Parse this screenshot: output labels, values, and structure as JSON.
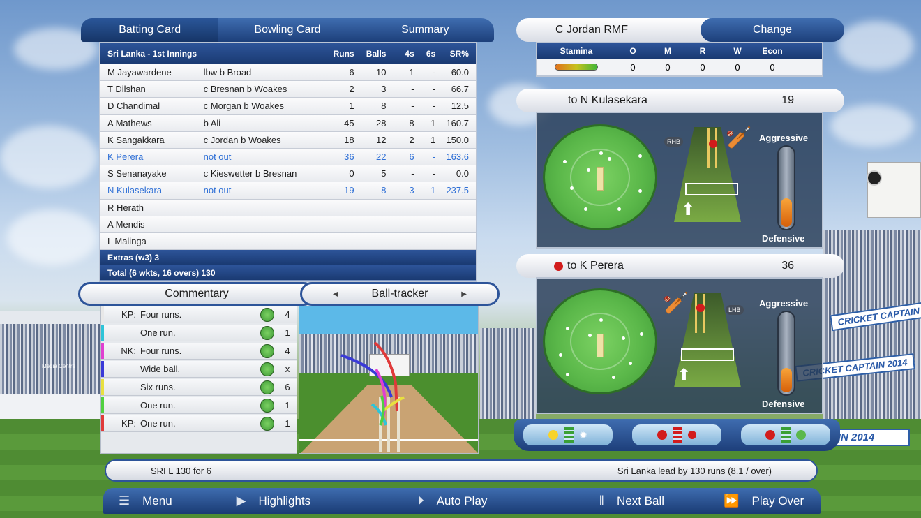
{
  "tabs": [
    "Batting Card",
    "Bowling Card",
    "Summary"
  ],
  "batting": {
    "innings_title": "Sri Lanka - 1st Innings",
    "headers": [
      "Runs",
      "Balls",
      "4s",
      "6s",
      "SR%"
    ],
    "rows": [
      {
        "name": "M Jayawardene",
        "how": "lbw b Broad",
        "runs": "6",
        "balls": "10",
        "fours": "1",
        "sixes": "-",
        "sr": "60.0"
      },
      {
        "name": "T Dilshan",
        "how": "c Bresnan b Woakes",
        "runs": "2",
        "balls": "3",
        "fours": "-",
        "sixes": "-",
        "sr": "66.7"
      },
      {
        "name": "D Chandimal",
        "how": "c Morgan b Woakes",
        "runs": "1",
        "balls": "8",
        "fours": "-",
        "sixes": "-",
        "sr": "12.5"
      },
      {
        "name": "A Mathews",
        "how": "b Ali",
        "runs": "45",
        "balls": "28",
        "fours": "8",
        "sixes": "1",
        "sr": "160.7"
      },
      {
        "name": "K Sangakkara",
        "how": "c Jordan b Woakes",
        "runs": "18",
        "balls": "12",
        "fours": "2",
        "sixes": "1",
        "sr": "150.0"
      },
      {
        "name": "K Perera",
        "how": "not out",
        "runs": "36",
        "balls": "22",
        "fours": "6",
        "sixes": "-",
        "sr": "163.6"
      },
      {
        "name": "S Senanayake",
        "how": "c Kieswetter b Bresnan",
        "runs": "0",
        "balls": "5",
        "fours": "-",
        "sixes": "-",
        "sr": "0.0"
      },
      {
        "name": "N Kulasekara",
        "how": "not out",
        "runs": "19",
        "balls": "8",
        "fours": "3",
        "sixes": "1",
        "sr": "237.5"
      },
      {
        "name": "R Herath",
        "how": "",
        "runs": "",
        "balls": "",
        "fours": "",
        "sixes": "",
        "sr": ""
      },
      {
        "name": "A Mendis",
        "how": "",
        "runs": "",
        "balls": "",
        "fours": "",
        "sixes": "",
        "sr": ""
      },
      {
        "name": "L Malinga",
        "how": "",
        "runs": "",
        "balls": "",
        "fours": "",
        "sixes": "",
        "sr": ""
      }
    ],
    "extras": "Extras (w3) 3",
    "total": "Total (6 wkts, 16 overs) 130"
  },
  "bowler": {
    "name": "C Jordan RMF",
    "change_label": "Change",
    "headers": [
      "Stamina",
      "O",
      "M",
      "R",
      "W",
      "Econ"
    ],
    "values": [
      "0",
      "0",
      "0",
      "0",
      "0"
    ],
    "stamina": 1.0
  },
  "field1": {
    "label": "to N Kulasekara",
    "score": "19",
    "hand": "RHB",
    "aggressive": "Aggressive",
    "defensive": "Defensive",
    "level": 0.35
  },
  "field2": {
    "label": "to K Perera",
    "score": "36",
    "hand": "LHB",
    "aggressive": "Aggressive",
    "defensive": "Defensive",
    "level": 0.3
  },
  "lower_tabs": {
    "commentary": "Commentary",
    "ball_tracker": "Ball-tracker"
  },
  "commentary": [
    {
      "who": "KP:",
      "text": "Four runs.",
      "val": "4",
      "color": "#e8e8e8"
    },
    {
      "who": "",
      "text": "One run.",
      "val": "1",
      "color": "#2ec4d8"
    },
    {
      "who": "NK:",
      "text": "Four runs.",
      "val": "4",
      "color": "#e040d0"
    },
    {
      "who": "",
      "text": "Wide ball.",
      "val": "x",
      "color": "#3a3ad8"
    },
    {
      "who": "",
      "text": "Six runs.",
      "val": "6",
      "color": "#e8e040"
    },
    {
      "who": "",
      "text": "One run.",
      "val": "1",
      "color": "#50d040"
    },
    {
      "who": "KP:",
      "text": "One run.",
      "val": "1",
      "color": "#e03a3a"
    }
  ],
  "status": {
    "left": "SRI L  130 for 6",
    "right": "Sri Lanka lead by 130 runs (8.1 / over)"
  },
  "bottom": {
    "menu": "Menu",
    "highlights": "Highlights",
    "auto_play": "Auto Play",
    "next_ball": "Next Ball",
    "play_over": "Play Over"
  },
  "banners": {
    "a": "CRICKET CAPTAIN 201",
    "b": "CRICKET CAPTAIN 2014",
    "c": "AIN 2014",
    "media": "Media Centre"
  }
}
